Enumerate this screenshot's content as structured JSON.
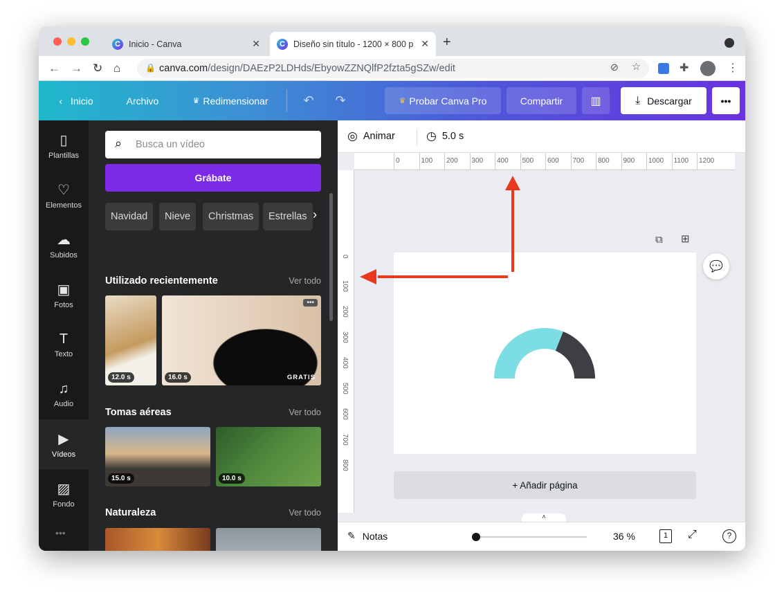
{
  "browser": {
    "tabs": [
      {
        "title": "Inicio - Canva"
      },
      {
        "title": "Diseño sin título - 1200 × 800 p"
      }
    ],
    "url_domain": "canva.com",
    "url_path": "/design/DAEzP2LDHds/EbyowZZNQlfP2fzta5gSZw/edit"
  },
  "toolbar": {
    "home": "Inicio",
    "file": "Archivo",
    "resize": "Redimensionar",
    "try_pro": "Probar Canva Pro",
    "share": "Compartir",
    "download": "Descargar"
  },
  "rail": [
    {
      "label": "Plantillas",
      "icon": "template-icon"
    },
    {
      "label": "Elementos",
      "icon": "elements-icon"
    },
    {
      "label": "Subidos",
      "icon": "upload-icon"
    },
    {
      "label": "Fotos",
      "icon": "photo-icon"
    },
    {
      "label": "Texto",
      "icon": "text-icon"
    },
    {
      "label": "Audio",
      "icon": "audio-icon"
    },
    {
      "label": "Vídeos",
      "icon": "video-icon",
      "active": true
    },
    {
      "label": "Fondo",
      "icon": "background-icon"
    }
  ],
  "panel": {
    "search_placeholder": "Busca un vídeo",
    "record": "Grábate",
    "chips": [
      "Navidad",
      "Nieve",
      "Christmas",
      "Estrellas"
    ],
    "sections": [
      {
        "title": "Utilizado recientemente",
        "see_all": "Ver todo",
        "items": [
          {
            "duration": "12.0 s"
          },
          {
            "duration": "16.0 s",
            "badge": "GRATIS"
          }
        ]
      },
      {
        "title": "Tomas aéreas",
        "see_all": "Ver todo",
        "items": [
          {
            "duration": "15.0 s"
          },
          {
            "duration": "10.0 s"
          }
        ]
      },
      {
        "title": "Naturaleza",
        "see_all": "Ver todo",
        "items": []
      }
    ]
  },
  "editor": {
    "animate": "Animar",
    "duration": "5.0 s",
    "hruler": [
      "0",
      "100",
      "200",
      "300",
      "400",
      "500",
      "600",
      "700",
      "800",
      "900",
      "1000",
      "1100",
      "1200"
    ],
    "vruler": [
      "0",
      "100",
      "200",
      "300",
      "400",
      "500",
      "600",
      "700",
      "800"
    ],
    "add_page": "+ Añadir página",
    "notes": "Notas",
    "zoom": "36 %",
    "page_count": "1",
    "donut": {
      "values": [
        62,
        38
      ],
      "colors": [
        "#7ddde4",
        "#3d3f44"
      ]
    }
  },
  "colors": {
    "accent": "#7d2ae8",
    "annotation": "#e8391f"
  }
}
